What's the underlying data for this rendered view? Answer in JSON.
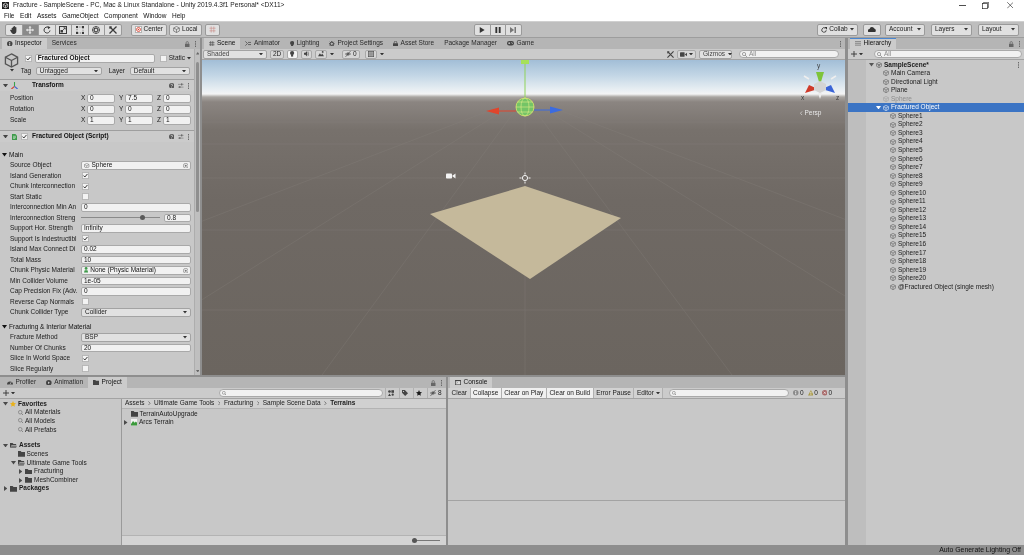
{
  "window": {
    "title": "Fracture - SampleScene - PC, Mac & Linux Standalone - Unity 2019.4.3f1 Personal* <DX11>"
  },
  "menu": [
    "File",
    "Edit",
    "Assets",
    "GameObject",
    "Component",
    "Window",
    "Help"
  ],
  "toolbar": {
    "tools": [
      {
        "kind": "hand",
        "selected": false
      },
      {
        "kind": "move",
        "selected": true
      },
      {
        "kind": "rotate",
        "selected": false
      },
      {
        "kind": "scale",
        "selected": false
      },
      {
        "kind": "rect",
        "selected": false
      },
      {
        "kind": "transform",
        "selected": false
      },
      {
        "kind": "custom",
        "selected": false
      }
    ],
    "pivot": "Center",
    "space": "Local",
    "playback": [
      {
        "kind": "play"
      },
      {
        "kind": "pause"
      },
      {
        "kind": "step"
      }
    ],
    "collab": "Collab",
    "account": "Account",
    "layers": "Layers",
    "layout": "Layout"
  },
  "inspector": {
    "tabs": [
      {
        "label": "Inspector",
        "kind": "inspector",
        "selected": true
      },
      {
        "label": "Services",
        "kind": "services",
        "selected": false
      }
    ],
    "object": {
      "active": true,
      "name": "Fractured Object",
      "static": false,
      "static_label": "Static",
      "tag_label": "Tag",
      "tag": "Untagged",
      "layer_label": "Layer",
      "layer": "Default"
    },
    "transform": {
      "title": "Transform",
      "expanded": true,
      "rows": [
        {
          "label": "Position",
          "values": [
            {
              "axis": "X",
              "value": "0"
            },
            {
              "axis": "Y",
              "value": "7.5"
            },
            {
              "axis": "Z",
              "value": "0"
            }
          ]
        },
        {
          "label": "Rotation",
          "values": [
            {
              "axis": "X",
              "value": "0"
            },
            {
              "axis": "Y",
              "value": "0"
            },
            {
              "axis": "Z",
              "value": "0"
            }
          ]
        },
        {
          "label": "Scale",
          "values": [
            {
              "axis": "X",
              "value": "1"
            },
            {
              "axis": "Y",
              "value": "1"
            },
            {
              "axis": "Z",
              "value": "1"
            }
          ]
        }
      ]
    },
    "script": {
      "title": "Fractured Object (Script)",
      "enabled": true,
      "expanded": true,
      "sections": [
        {
          "title": "Main",
          "expanded": true,
          "fields": [
            {
              "kind": "mesh",
              "label": "Source Object",
              "value": "Sphere"
            },
            {
              "kind": "checkbox",
              "label": "Island Generation",
              "checked": true
            },
            {
              "kind": "checkbox",
              "label": "Chunk Interconnection",
              "checked": true
            },
            {
              "kind": "checkbox",
              "label": "Start Static",
              "checked": false
            },
            {
              "kind": "number",
              "label": "Interconnection Min An",
              "value": "0"
            },
            {
              "kind": "slider",
              "label": "Interconnection Streng",
              "level": 0.8,
              "value": "0.8"
            },
            {
              "kind": "number",
              "label": "Support Hor. Strength",
              "value": "Infinity"
            },
            {
              "kind": "checkbox",
              "label": "Support Is Indestructibl",
              "checked": true
            },
            {
              "kind": "number",
              "label": "Island Max Connect Di",
              "value": "0.02"
            },
            {
              "kind": "number",
              "label": "Total Mass",
              "value": "10"
            },
            {
              "kind": "material",
              "label": "Chunk Physic Material",
              "value": "None (Physic Material)"
            },
            {
              "kind": "number",
              "label": "Min Collider Volume",
              "value": "1e-05"
            },
            {
              "kind": "number",
              "label": "Cap Precision Fix (Adv.",
              "value": "0"
            },
            {
              "kind": "checkbox",
              "label": "Reverse Cap Normals",
              "checked": false
            },
            {
              "kind": "dropdown",
              "label": "Chunk Collider Type",
              "value": "Collider"
            }
          ]
        },
        {
          "title": "Fracturing & Interior Material",
          "expanded": true,
          "fields": [
            {
              "kind": "dropdown",
              "label": "Fracture Method",
              "value": "BSP"
            },
            {
              "kind": "number",
              "label": "Number Of Chunks",
              "value": "20"
            },
            {
              "kind": "checkbox",
              "label": "Slice In World Space",
              "checked": true
            },
            {
              "kind": "checkbox",
              "label": "Slice Regularly",
              "checked": false
            }
          ]
        }
      ]
    }
  },
  "scene": {
    "tabs": [
      {
        "label": "Scene",
        "kind": "scene",
        "selected": true
      },
      {
        "label": "Animator",
        "kind": "animator",
        "selected": false
      },
      {
        "label": "Lighting",
        "kind": "lighting",
        "selected": false
      },
      {
        "label": "Project Settings",
        "kind": "settings",
        "selected": false
      },
      {
        "label": "Asset Store",
        "kind": "store",
        "selected": false
      },
      {
        "label": "Package Manager",
        "kind": "packages",
        "selected": false
      },
      {
        "label": "Game",
        "kind": "game",
        "selected": false
      }
    ],
    "toolbar": {
      "draw_mode": "Shaded",
      "toggles": [
        {
          "kind": "flat",
          "label": "2D",
          "on": false
        },
        {
          "kind": "lighting",
          "on": true
        },
        {
          "kind": "audio",
          "on": false
        },
        {
          "kind": "effects",
          "on": false
        }
      ],
      "hidden_count": "0",
      "gizmos": "Gizmos",
      "search": {
        "placeholder": "All"
      }
    },
    "viewport": {
      "gizmo_axes": [
        "y",
        "x",
        "z"
      ],
      "projection": "Persp"
    }
  },
  "hierarchy": {
    "tabs": [
      {
        "label": "Hierarchy",
        "kind": "hierarchy",
        "selected": true
      }
    ],
    "search": {
      "placeholder": "All"
    },
    "tree": [
      {
        "label": "SampleScene*",
        "kind": "scene",
        "expanded": true,
        "selected": false,
        "disabled": false,
        "children": [
          {
            "label": "Main Camera",
            "kind": "object",
            "selected": false,
            "disabled": false
          },
          {
            "label": "Directional Light",
            "kind": "object",
            "selected": false,
            "disabled": false
          },
          {
            "label": "Plane",
            "kind": "object",
            "selected": false,
            "disabled": false
          },
          {
            "label": "Sphere",
            "kind": "object",
            "selected": false,
            "disabled": true
          },
          {
            "label": "Fractured Object",
            "kind": "object",
            "expanded": true,
            "selected": true,
            "disabled": false,
            "children": [
              {
                "label": "Sphere1",
                "kind": "object",
                "selected": false,
                "disabled": false
              },
              {
                "label": "Sphere2",
                "kind": "object",
                "selected": false,
                "disabled": false
              },
              {
                "label": "Sphere3",
                "kind": "object",
                "selected": false,
                "disabled": false
              },
              {
                "label": "Sphere4",
                "kind": "object",
                "selected": false,
                "disabled": false
              },
              {
                "label": "Sphere5",
                "kind": "object",
                "selected": false,
                "disabled": false
              },
              {
                "label": "Sphere6",
                "kind": "object",
                "selected": false,
                "disabled": false
              },
              {
                "label": "Sphere7",
                "kind": "object",
                "selected": false,
                "disabled": false
              },
              {
                "label": "Sphere8",
                "kind": "object",
                "selected": false,
                "disabled": false
              },
              {
                "label": "Sphere9",
                "kind": "object",
                "selected": false,
                "disabled": false
              },
              {
                "label": "Sphere10",
                "kind": "object",
                "selected": false,
                "disabled": false
              },
              {
                "label": "Sphere11",
                "kind": "object",
                "selected": false,
                "disabled": false
              },
              {
                "label": "Sphere12",
                "kind": "object",
                "selected": false,
                "disabled": false
              },
              {
                "label": "Sphere13",
                "kind": "object",
                "selected": false,
                "disabled": false
              },
              {
                "label": "Sphere14",
                "kind": "object",
                "selected": false,
                "disabled": false
              },
              {
                "label": "Sphere15",
                "kind": "object",
                "selected": false,
                "disabled": false
              },
              {
                "label": "Sphere16",
                "kind": "object",
                "selected": false,
                "disabled": false
              },
              {
                "label": "Sphere17",
                "kind": "object",
                "selected": false,
                "disabled": false
              },
              {
                "label": "Sphere18",
                "kind": "object",
                "selected": false,
                "disabled": false
              },
              {
                "label": "Sphere19",
                "kind": "object",
                "selected": false,
                "disabled": false
              },
              {
                "label": "Sphere20",
                "kind": "object",
                "selected": false,
                "disabled": false
              },
              {
                "label": "@Fractured Object (single mesh)",
                "kind": "object",
                "selected": false,
                "disabled": false
              }
            ]
          }
        ]
      }
    ]
  },
  "project": {
    "tabs": [
      {
        "label": "Profiler",
        "kind": "profiler",
        "selected": false
      },
      {
        "label": "Animation",
        "kind": "animation",
        "selected": false
      },
      {
        "label": "Project",
        "kind": "project",
        "selected": true
      }
    ],
    "hidden_count": "8",
    "tree": [
      {
        "label": "Favorites",
        "kind": "favorites",
        "expanded": true,
        "selected": false,
        "children": [
          {
            "label": "All Materials",
            "kind": "search",
            "selected": false
          },
          {
            "label": "All Models",
            "kind": "search",
            "selected": false
          },
          {
            "label": "All Prefabs",
            "kind": "search",
            "selected": false
          }
        ]
      },
      {
        "label": "Assets",
        "kind": "folder",
        "expanded": true,
        "selected": false,
        "children": [
          {
            "label": "Scenes",
            "kind": "folder",
            "selected": false
          },
          {
            "label": "Ultimate Game Tools",
            "kind": "folder",
            "expanded": true,
            "selected": false,
            "children": [
              {
                "label": "Fracturing",
                "kind": "folder",
                "expanded": false,
                "selected": false
              },
              {
                "label": "MeshCombiner",
                "kind": "folder",
                "expanded": false,
                "selected": false
              }
            ]
          }
        ]
      },
      {
        "label": "Packages",
        "kind": "folder",
        "expanded": false,
        "selected": false
      }
    ],
    "breadcrumb": [
      "Assets",
      "Ultimate Game Tools",
      "Fracturing",
      "Sample Scene Data",
      "Terrains"
    ],
    "items": [
      {
        "label": "TerrainAutoUpgrade",
        "kind": "folder",
        "selected": false
      },
      {
        "label": "Arcs Terrain",
        "kind": "terrain",
        "expanded": false,
        "selected": false
      }
    ],
    "zoom_slider": {
      "level": 0
    }
  },
  "console": {
    "tabs": [
      {
        "label": "Console",
        "kind": "console",
        "selected": true
      }
    ],
    "buttons": [
      {
        "kind": "button",
        "label": "Clear"
      },
      {
        "kind": "toggle",
        "label": "Collapse",
        "on": true
      },
      {
        "kind": "toggle",
        "label": "Clear on Play",
        "on": true
      },
      {
        "kind": "toggle",
        "label": "Clear on Build",
        "on": true
      },
      {
        "kind": "toggle",
        "label": "Error Pause",
        "on": false
      },
      {
        "kind": "dropdown",
        "label": "Editor"
      }
    ],
    "counts": [
      {
        "kind": "info",
        "value": "0"
      },
      {
        "kind": "warning",
        "value": "0"
      },
      {
        "kind": "error",
        "value": "0"
      }
    ]
  },
  "status_bar": {
    "text": "Auto Generate Lighting Off"
  }
}
